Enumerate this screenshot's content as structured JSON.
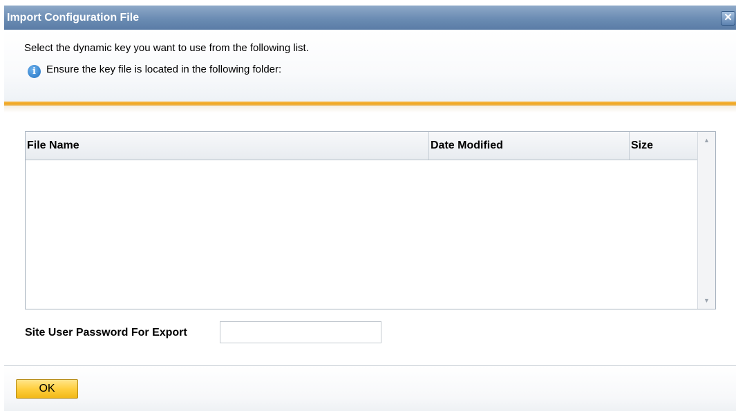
{
  "dialog": {
    "title": "Import Configuration File",
    "close_icon": "close-icon",
    "close_glyph": "✕"
  },
  "header": {
    "instruction": "Select the dynamic key you want to use from the following list.",
    "info_icon": "info-icon",
    "info_glyph": "i",
    "info_text": "Ensure the key file is located in the following folder:"
  },
  "table": {
    "columns": [
      "File Name",
      "Date Modified",
      "Size"
    ],
    "rows": [],
    "scroll_up_glyph": "▲",
    "scroll_down_glyph": "▼"
  },
  "password": {
    "label": "Site User Password For Export",
    "value": "",
    "placeholder": ""
  },
  "footer": {
    "ok_label": "OK"
  },
  "colors": {
    "titlebar": "#6b8cb3",
    "accent_bar": "#f0a51e",
    "ok_button": "#ffcf3f",
    "info_icon": "#1f6fc0"
  }
}
